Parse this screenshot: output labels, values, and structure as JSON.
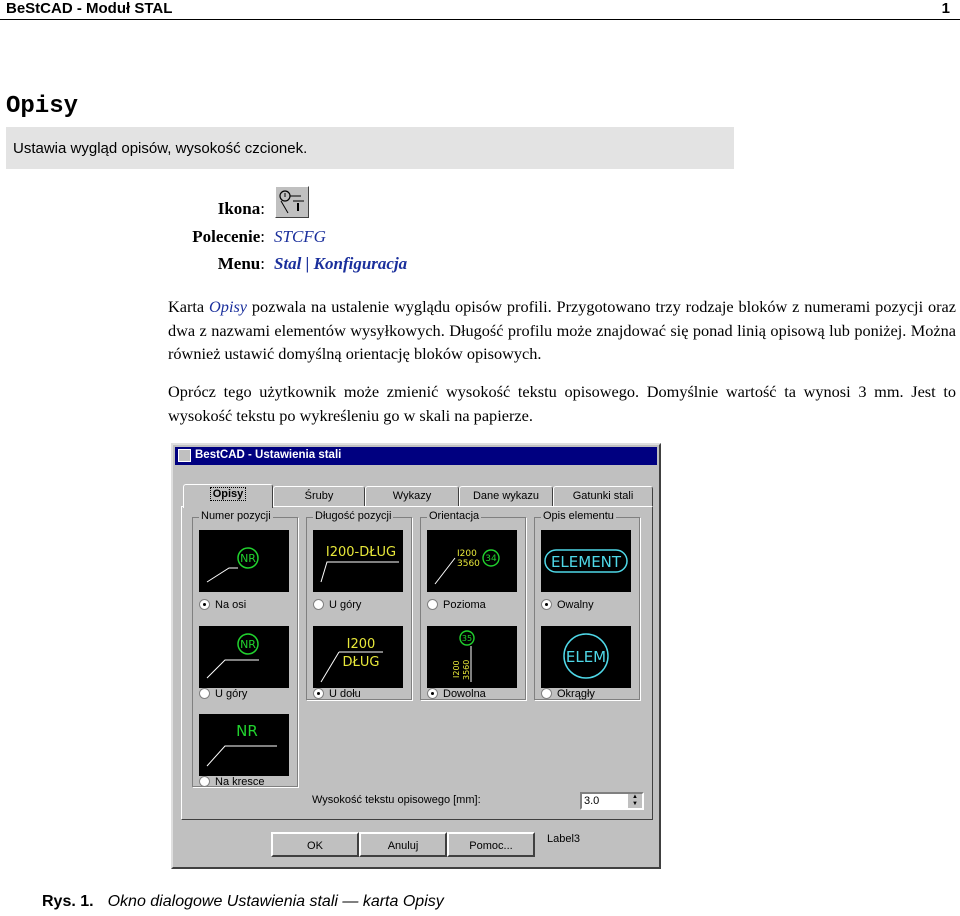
{
  "header": {
    "title": "BeStCAD - Moduł STAL",
    "page": "1"
  },
  "section": {
    "title": "Opisy",
    "summary": "Ustawia wygląd opisów, wysokość czcionek."
  },
  "meta": {
    "ikona_label": "Ikona",
    "polecenie_label": "Polecenie",
    "menu_label": "Menu",
    "colon": ":",
    "polecenie_value": "STCFG",
    "menu_value": "Stal | Konfiguracja"
  },
  "body": {
    "p1_a": "Karta ",
    "p1_em": "Opisy",
    "p1_b": " pozwala na ustalenie wyglądu opisów profili. Przygotowano trzy rodzaje bloków z numerami pozycji oraz dwa z nazwami elementów wysyłkowych. Długość profilu może znajdować się ponad linią opisową lub poniżej. Można również ustawić domyślną orientację bloków opisowych.",
    "p2": "Oprócz tego użytkownik może zmienić wysokość tekstu opisowego. Domyślnie wartość ta wynosi 3 mm. Jest to wysokość tekstu po wykreśleniu go w skali na papierze."
  },
  "dialog": {
    "title": "BestCAD - Ustawienia stali",
    "tabs": [
      "Opisy",
      "Śruby",
      "Wykazy",
      "Dane wykazu",
      "Gatunki stali"
    ],
    "groups": [
      "Numer pozycji",
      "Długość pozycji",
      "Orientacja",
      "Opis elementu"
    ],
    "previews": {
      "nr": "NR",
      "i200_dlug": "I200-DŁUG",
      "i200": "I200",
      "dlug": "DŁUG",
      "i200v": "I200",
      "n3560": "3560",
      "n34": "34",
      "n35": "35",
      "element": "ELEMENT",
      "elem": "ELEM"
    },
    "radios": {
      "na_osi": "Na osi",
      "u_gory_1": "U góry",
      "na_kresce": "Na kresce",
      "u_gory_2": "U góry",
      "u_dolu": "U dołu",
      "pozioma": "Pozioma",
      "dowolna": "Dowolna",
      "owalny": "Owalny",
      "okragly": "Okrągły"
    },
    "height_label": "Wysokość tekstu opisowego [mm]:",
    "height_value": "3.0",
    "buttons": {
      "ok": "OK",
      "cancel": "Anuluj",
      "help": "Pomoc..."
    },
    "label3": "Label3"
  },
  "caption": {
    "num": "Rys. 1.",
    "text": "Okno dialogowe Ustawienia stali — karta Opisy"
  },
  "colors": {
    "accent_text": "#1a2f9c",
    "preview_green": "#21d22e",
    "preview_yellow": "#e8e83a",
    "preview_cyan": "#4fd8e8",
    "titlebar": "#000080"
  }
}
